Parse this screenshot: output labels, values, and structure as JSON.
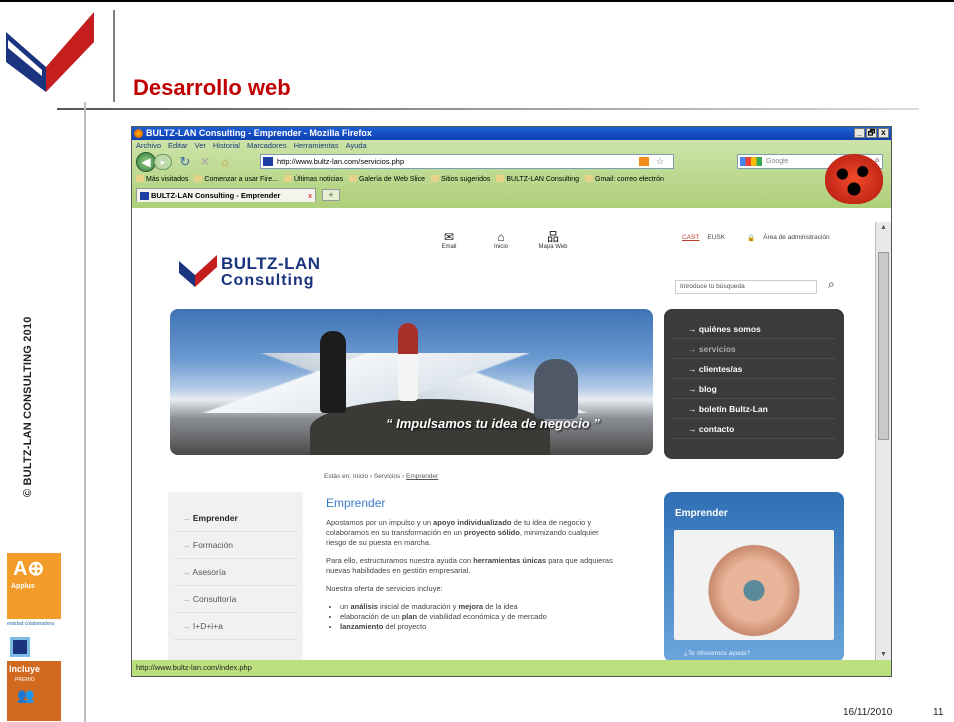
{
  "slide": {
    "title": "Desarrollo web",
    "vertical_text": "© BULTZ-LAN CONSULTING 2010",
    "date": "16/11/2010",
    "page_number": "11",
    "badges": {
      "applus": "Applus",
      "entidad": "entidad colaboradora",
      "incluye": "Incluye",
      "premio": "PREMIO"
    }
  },
  "browser": {
    "window_title": "BULTZ-LAN Consulting - Emprender - Mozilla Firefox",
    "window_buttons": [
      "_",
      "🗗",
      "x"
    ],
    "menu": [
      "Archivo",
      "Editar",
      "Ver",
      "Historial",
      "Marcadores",
      "Herramientas",
      "Ayuda"
    ],
    "url": "http://www.bultz-lan.com/servicios.php",
    "search_placeholder": "Google",
    "bookmarks": [
      "Más visitados",
      "Comenzar a usar Fire...",
      "Últimas noticias",
      "Galería de Web Slice",
      "Sitios sugeridos",
      "BULTZ-LAN Consulting",
      "Gmail: correo electrón"
    ],
    "tab_label": "BULTZ-LAN Consulting - Emprender",
    "tab_close": "x",
    "new_tab": "+",
    "status_text": "http://www.bultz-lan.com/index.php"
  },
  "site": {
    "top_links": [
      {
        "icon": "envelope-icon",
        "glyph": "⌂",
        "label": "Email"
      },
      {
        "icon": "home-icon",
        "glyph": "⌂",
        "label": "Inicio"
      },
      {
        "icon": "sitemap-icon",
        "glyph": "品",
        "label": "Mapa Web"
      }
    ],
    "lang_cast": "CAST",
    "lang_eusk": "EUSK",
    "admin_link": "Área de administración",
    "logo_line1": "BULTZ-LAN",
    "logo_line2": "Consulting",
    "search_placeholder": "Introduce tu búsqueda",
    "hero_quote": "“ Impulsamos tu idea de negocio ”",
    "nav": [
      "quiénes somos",
      "servicios",
      "clientes/as",
      "blog",
      "boletín Bultz-Lan",
      "contacto"
    ],
    "breadcrumb": {
      "prefix": "Estás en:",
      "items": [
        "Inicio",
        "Servicios"
      ],
      "current": "Emprender"
    },
    "side_menu": [
      "Emprender",
      "Formación",
      "Asesoría",
      "Consultoría",
      "I+D+i+a"
    ],
    "main": {
      "heading": "Emprender",
      "p1_a": "Apostamos por un impulso y un ",
      "p1_b": "apoyo individualizado",
      "p1_c": " de tu idea de negocio y colaboramos en su transformación en un ",
      "p1_d": "proyecto sólido",
      "p1_e": ", minimizando cualquier riesgo de su puesta en marcha.",
      "p2_a": "Para ello, estructuramos nuestra ayuda con ",
      "p2_b": "herramientas únicas",
      "p2_c": " para que adquieras nuevas habilidades en gestión empresarial.",
      "p3": "Nuestra oferta de servicios incluye:",
      "list": [
        {
          "a": "un ",
          "b": "análisis",
          "c": " inicial de maduración y ",
          "d": "mejora",
          "e": " de la idea"
        },
        {
          "a": "elaboración de un ",
          "b": "plan",
          "c": " de viabilidad económica y de mercado",
          "d": "",
          "e": ""
        },
        {
          "a": "",
          "b": "lanzamiento",
          "c": " del proyecto",
          "d": "",
          "e": ""
        }
      ]
    },
    "promo_title": "Emprender",
    "promo_link": "¿Te ofrecemos ayuda?"
  },
  "colors": {
    "title_red": "#c00000",
    "brand_blue": "#1b3480",
    "link_blue": "#3a7bc8",
    "firefox_green": "#aed07a"
  }
}
